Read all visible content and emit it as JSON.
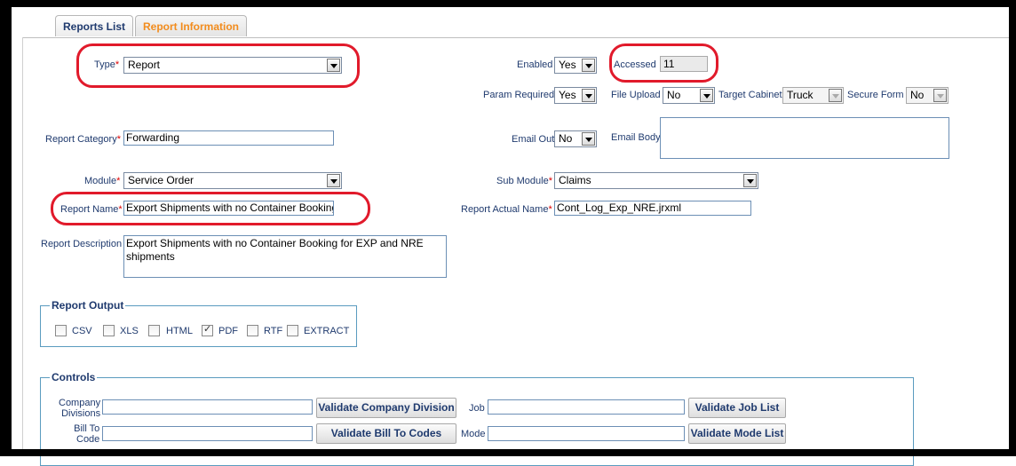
{
  "tabs": {
    "reports_list": "Reports List",
    "report_information": "Report Information"
  },
  "type": {
    "label": "Type",
    "value": "Report"
  },
  "enabled": {
    "label": "Enabled",
    "value": "Yes"
  },
  "accessed": {
    "label": "Accessed",
    "value": "11"
  },
  "param_required": {
    "label": "Param Required",
    "value": "Yes"
  },
  "file_upload": {
    "label": "File Upload",
    "value": "No"
  },
  "target_cabinet": {
    "label": "Target Cabinet",
    "value": "Truck"
  },
  "secure_form": {
    "label": "Secure Form",
    "value": "No"
  },
  "report_category": {
    "label": "Report Category",
    "value": "Forwarding"
  },
  "email_out": {
    "label": "Email Out",
    "value": "No"
  },
  "email_body": {
    "label": "Email Body",
    "value": ""
  },
  "module": {
    "label": "Module",
    "value": "Service Order"
  },
  "sub_module": {
    "label": "Sub Module",
    "value": "Claims"
  },
  "report_name": {
    "label": "Report Name",
    "value": "Export Shipments with no Container Booking"
  },
  "report_actual_name": {
    "label": "Report Actual Name",
    "value": "Cont_Log_Exp_NRE.jrxml"
  },
  "report_description": {
    "label": "Report Description",
    "value": "Export Shipments with no Container Booking for EXP and NRE shipments"
  },
  "report_output": {
    "legend": "Report Output",
    "options": [
      {
        "label": "CSV",
        "checked": false
      },
      {
        "label": "XLS",
        "checked": false
      },
      {
        "label": "HTML",
        "checked": false
      },
      {
        "label": "PDF",
        "checked": true
      },
      {
        "label": "RTF",
        "checked": false
      },
      {
        "label": "EXTRACT",
        "checked": false
      }
    ]
  },
  "controls": {
    "legend": "Controls",
    "company_divisions_label_1": "Company",
    "company_divisions_label_2": "Divisions",
    "validate_company_division": "Validate Company Division",
    "job_label": "Job",
    "validate_job_list": "Validate Job List",
    "bill_to_code_label_1": "Bill To",
    "bill_to_code_label_2": "Code",
    "validate_bill_to_codes": "Validate Bill To Codes",
    "mode_label": "Mode",
    "validate_mode_list": "Validate Mode List"
  },
  "colors": {
    "annotation": "#e11a2b",
    "label": "#1f3a6e",
    "active_tab": "#f28c1d",
    "fieldset_border": "#5a9bbf"
  }
}
